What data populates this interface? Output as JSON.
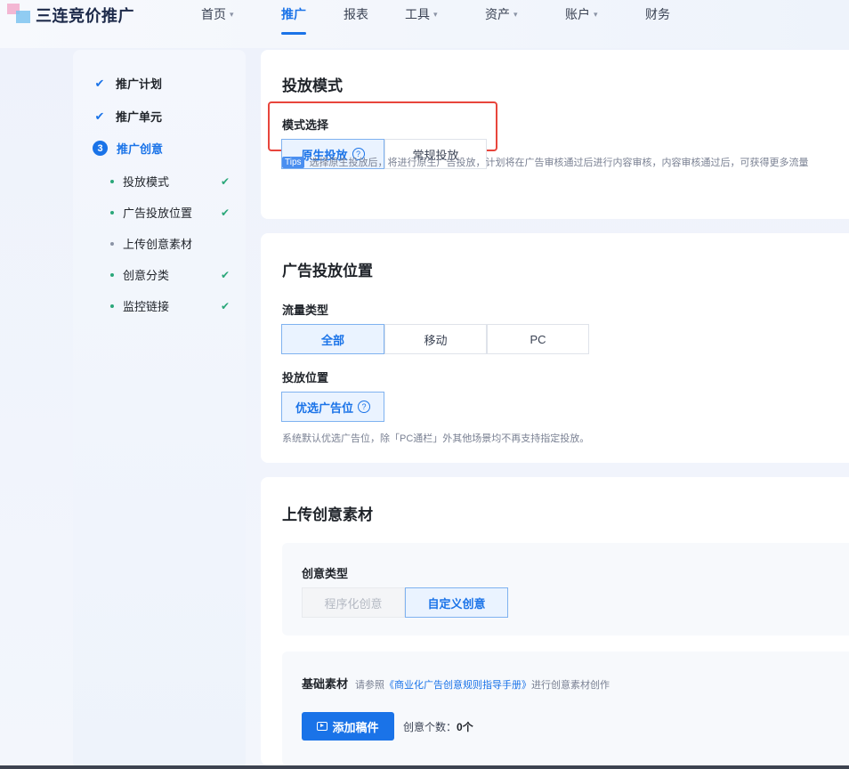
{
  "app": {
    "logo_text": "三连竞价推广"
  },
  "nav": {
    "items": [
      {
        "label": "首页",
        "has_caret": true
      },
      {
        "label": "推广",
        "active": true
      },
      {
        "label": "报表"
      },
      {
        "label": "工具",
        "has_caret": true
      },
      {
        "label": "资产",
        "has_caret": true
      },
      {
        "label": "账户",
        "has_caret": true
      },
      {
        "label": "财务"
      }
    ],
    "caret": "▾"
  },
  "sidebar": {
    "steps": [
      {
        "label": "推广计划",
        "status": "done",
        "icon": "✔"
      },
      {
        "label": "推广单元",
        "status": "done",
        "icon": "✔"
      },
      {
        "label": "推广创意",
        "status": "current",
        "number": "3"
      }
    ],
    "substeps": [
      {
        "label": "投放模式",
        "done": true
      },
      {
        "label": "广告投放位置",
        "done": true
      },
      {
        "label": "上传创意素材",
        "done": false
      },
      {
        "label": "创意分类",
        "done": true
      },
      {
        "label": "监控链接",
        "done": true
      }
    ],
    "check_glyph": "✔"
  },
  "mode_section": {
    "title": "投放模式",
    "label": "模式选择",
    "options": [
      "原生投放",
      "常规投放"
    ],
    "selected": "原生投放",
    "help_glyph": "?",
    "tips_tag": "Tips",
    "tips_text": "选择原生投放后，将进行原生广告投放，计划将在广告审核通过后进行内容审核，内容审核通过后，可获得更多流量"
  },
  "placement_section": {
    "title": "广告投放位置",
    "traffic_label": "流量类型",
    "traffic_options": [
      "全部",
      "移动",
      "PC"
    ],
    "traffic_selected": "全部",
    "position_label": "投放位置",
    "position_button": "优选广告位",
    "position_hint": "系统默认优选广告位，除「PC通栏」外其他场景均不再支持指定投放。"
  },
  "upload_section": {
    "title": "上传创意素材",
    "creative_type_label": "创意类型",
    "creative_types": [
      "程序化创意",
      "自定义创意"
    ],
    "creative_selected": "自定义创意",
    "base_title": "基础素材",
    "base_hint_pre": "请参照",
    "base_hint_link": "《商业化广告创意规则指导手册》",
    "base_hint_post": "进行创意素材创作",
    "add_button": "添加稿件",
    "count_label": "创意个数：",
    "count_value": "0个"
  },
  "colors": {
    "primary": "#1a73e8",
    "success": "#2aa779",
    "highlight_box": "#e8453c"
  }
}
